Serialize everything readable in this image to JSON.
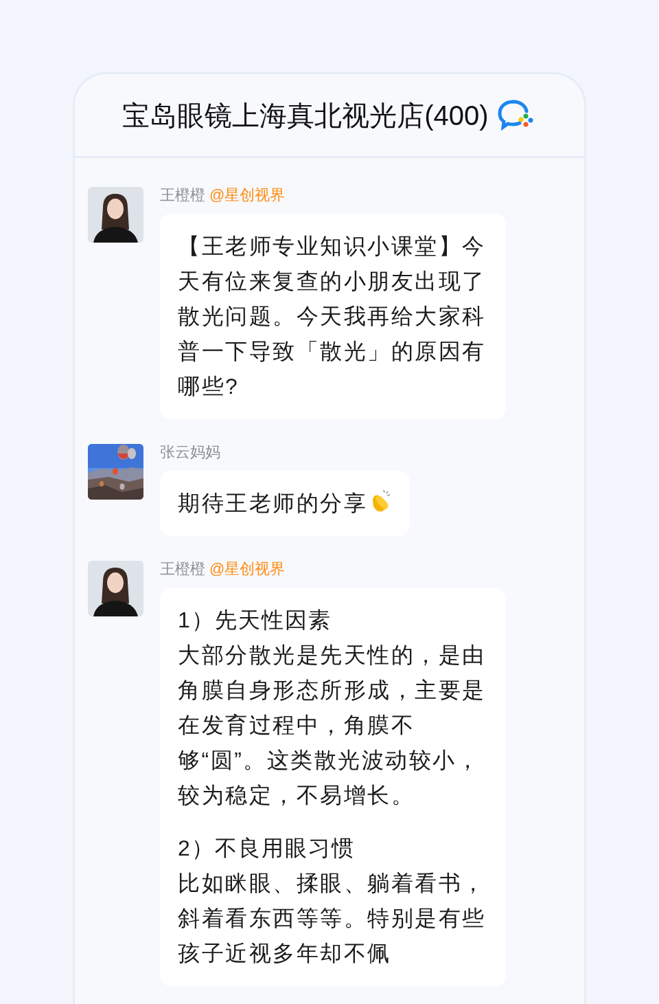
{
  "header": {
    "title": "宝岛眼镜上海真北视光店(400)"
  },
  "messages": [
    {
      "sender": "王橙橙",
      "mention": "@星创视界",
      "avatar": {
        "kind": "person"
      },
      "paragraphs": [
        {
          "text": "【王老师专业知识小课堂】今天有位来复查的小朋友出现了散光问题。今天我再给大家科普一下导致「散光」的原因有哪些?"
        }
      ],
      "emoji": false
    },
    {
      "sender": "张云妈妈",
      "avatar": {
        "kind": "picture"
      },
      "paragraphs": [
        {
          "text": "期待王老师的分享"
        }
      ],
      "emoji": true
    },
    {
      "sender": "王橙橙",
      "mention": "@星创视界",
      "avatar": {
        "kind": "person"
      },
      "paragraphs": [
        {
          "heading": "1）先天性因素",
          "text": "大部分散光是先天性的，是由角膜自身形态所形成，主要是在发育过程中，角膜不够“圆”。这类散光波动较小，较为稳定，不易增长。"
        },
        {
          "heading": "2）不良用眼习惯",
          "text": "比如眯眼、揉眼、躺着看书，斜着看东西等等。特别是有些孩子近视多年却不佩"
        }
      ],
      "emoji": false
    }
  ]
}
